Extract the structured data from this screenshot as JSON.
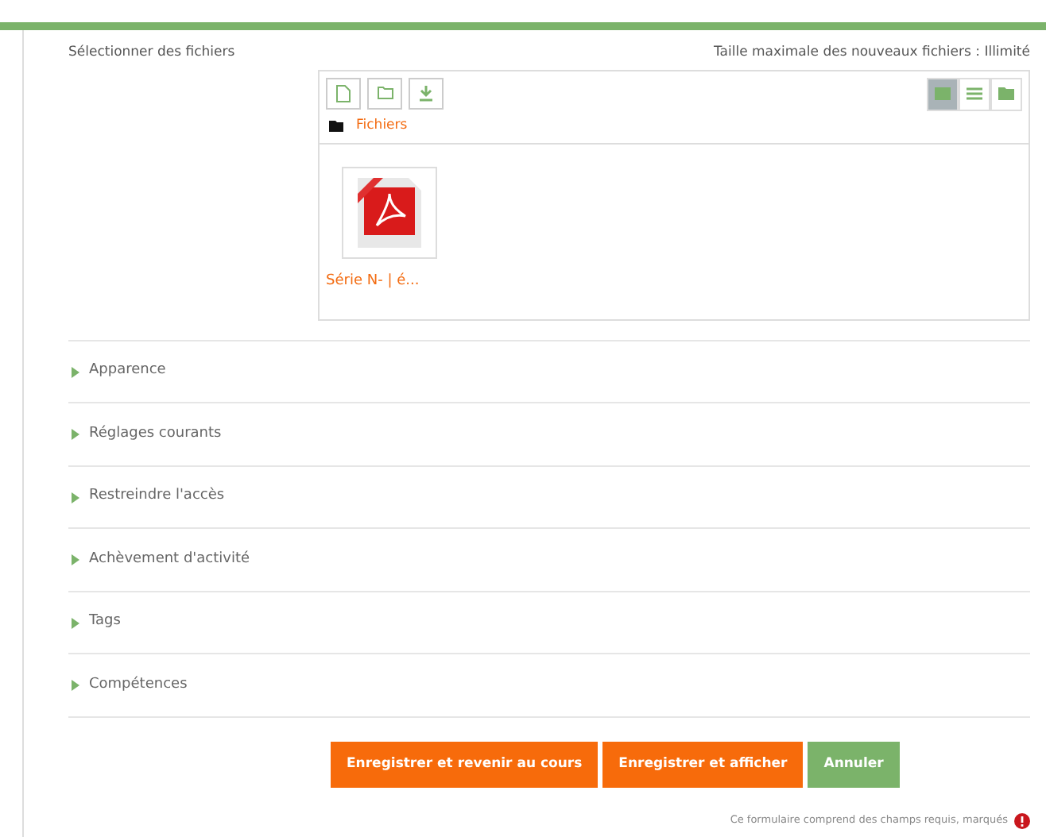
{
  "file_picker": {
    "label": "Sélectionner des fichiers",
    "max_size": "Taille maximale des nouveaux fichiers : Illimité",
    "toolbar": [
      {
        "kind": "file"
      },
      {
        "kind": "folder"
      },
      {
        "kind": "download"
      }
    ],
    "view_modes": [
      {
        "kind": "icons",
        "selected": true
      },
      {
        "kind": "list",
        "selected": false
      },
      {
        "kind": "tree",
        "selected": false
      }
    ],
    "path": "Fichiers",
    "files": [
      {
        "name": "Série N- | é..."
      }
    ]
  },
  "sections": [
    {
      "title": "Apparence",
      "expanded": false
    },
    {
      "title": "Réglages courants",
      "expanded": false
    },
    {
      "title": "Restreindre l'accès",
      "expanded": false
    },
    {
      "title": "Achèvement d'activité",
      "expanded": false
    },
    {
      "title": "Tags",
      "expanded": false
    },
    {
      "title": "Compétences",
      "expanded": false
    }
  ],
  "buttons": [
    {
      "label": "Enregistrer et revenir au cours",
      "kind": "primary"
    },
    {
      "label": "Enregistrer et afficher",
      "kind": "primary"
    },
    {
      "label": "Annuler",
      "kind": "secondary"
    }
  ],
  "required_note": "Ce formulaire comprend des champs requis, marqués"
}
